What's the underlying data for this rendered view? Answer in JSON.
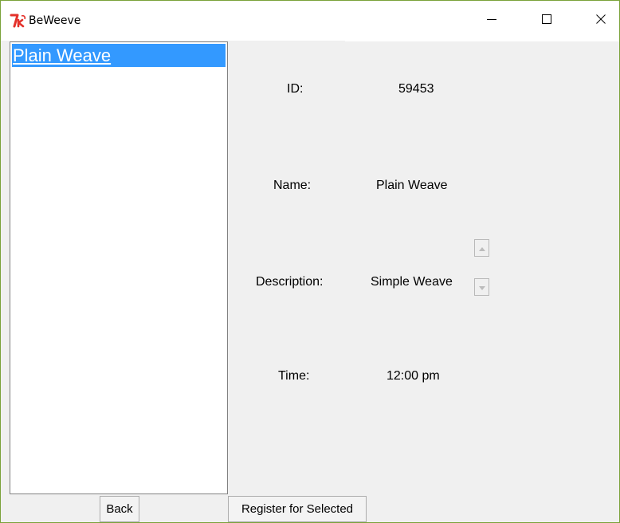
{
  "window": {
    "title": "BeWeeve",
    "icon": "tk-feather-icon",
    "controls": [
      "minimize-icon",
      "maximize-icon",
      "close-icon"
    ]
  },
  "list": {
    "items": [
      {
        "label": "Plain Weave",
        "selected": true
      }
    ]
  },
  "details": {
    "id_label": "ID:",
    "id_value": "59453",
    "name_label": "Name:",
    "name_value": "Plain Weave",
    "description_label": "Description:",
    "description_value": "Simple Weave",
    "time_label": "Time:",
    "time_value": "12:00 pm"
  },
  "buttons": {
    "back_label": "Back",
    "register_label": "Register for Selected"
  },
  "colors": {
    "selection": "#3399ff",
    "window_border": "#7aa23a",
    "background": "#f0f0f0"
  }
}
